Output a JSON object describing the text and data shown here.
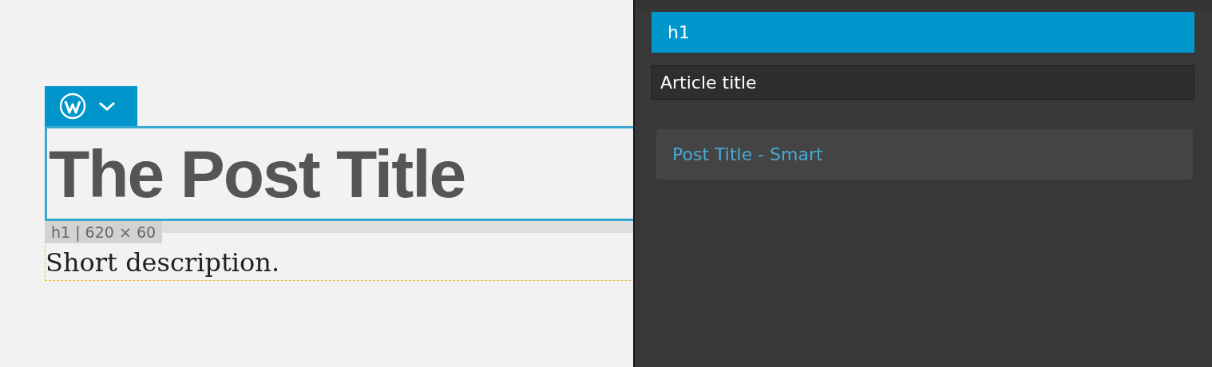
{
  "canvas": {
    "title": "The Post Title",
    "element_label": "h1 | 620 × 60",
    "description": "Short description."
  },
  "panel": {
    "items": [
      {
        "label": "h1",
        "selected": true
      }
    ],
    "name_field": {
      "value": "Article title"
    },
    "suggestion": {
      "label": "Post Title - Smart"
    }
  }
}
